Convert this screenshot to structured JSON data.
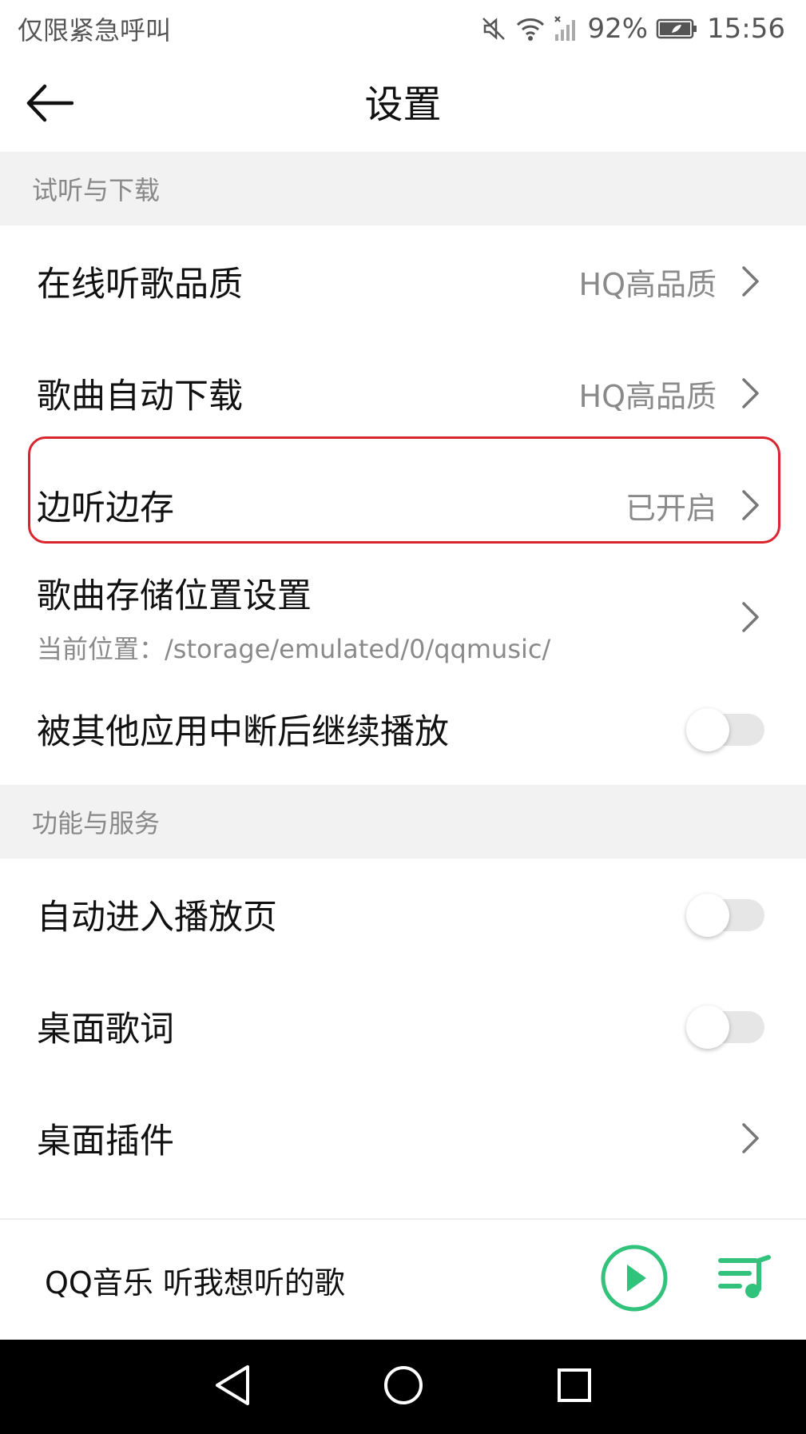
{
  "status_bar": {
    "carrier": "仅限紧急呼叫",
    "battery": "92%",
    "time": "15:56"
  },
  "header": {
    "title": "设置"
  },
  "sections": [
    {
      "title": "试听与下载",
      "rows": [
        {
          "label": "在线听歌品质",
          "value": "HQ高品质"
        },
        {
          "label": "歌曲自动下载",
          "value": "HQ高品质"
        },
        {
          "label": "边听边存",
          "value": "已开启"
        },
        {
          "label": "歌曲存储位置设置",
          "subtitle": "当前位置：/storage/emulated/0/qqmusic/"
        },
        {
          "label": "被其他应用中断后继续播放",
          "toggle": false
        }
      ]
    },
    {
      "title": "功能与服务",
      "rows": [
        {
          "label": "自动进入播放页",
          "toggle": false
        },
        {
          "label": "桌面歌词",
          "toggle": false
        },
        {
          "label": "桌面插件"
        }
      ]
    }
  ],
  "mini_player": {
    "text": "QQ音乐 听我想听的歌"
  },
  "colors": {
    "accent_green": "#31c27c",
    "highlight_red": "#d9252e",
    "section_bg": "#f2f2f2"
  },
  "icons": [
    "back-arrow-icon",
    "mute-icon",
    "wifi-icon",
    "signal-icon",
    "battery-icon",
    "chevron-right-icon",
    "play-icon",
    "playlist-icon",
    "nav-back-icon",
    "nav-home-icon",
    "nav-recents-icon"
  ]
}
